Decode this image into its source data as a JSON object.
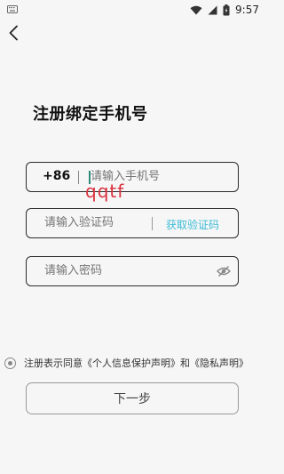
{
  "status_bar": {
    "left_icon": "keyboard-icon",
    "icons": [
      "wifi-icon",
      "signal-icon",
      "battery-icon"
    ],
    "time": "9:57"
  },
  "nav": {
    "back_icon": "back-arrow-icon"
  },
  "title": "注册绑定手机号",
  "phone_field": {
    "country_code": "+86",
    "placeholder": "请输入手机号",
    "value": ""
  },
  "overlay_text": "qqtf",
  "code_field": {
    "placeholder": "请输入验证码",
    "value": "",
    "get_code_label": "获取验证码"
  },
  "password_field": {
    "placeholder": "请输入密码",
    "value": "",
    "visibility_icon": "eye-off-icon"
  },
  "agreement": {
    "text": "注册表示同意《个人信息保护声明》和《隐私声明》",
    "checked": true
  },
  "next_button": {
    "label": "下一步"
  },
  "colors": {
    "background": "#f6f6f6",
    "field_border": "#2b2b2b",
    "link": "#3cbcd6",
    "overlay": "#d9333f",
    "muted_border": "#999999"
  }
}
